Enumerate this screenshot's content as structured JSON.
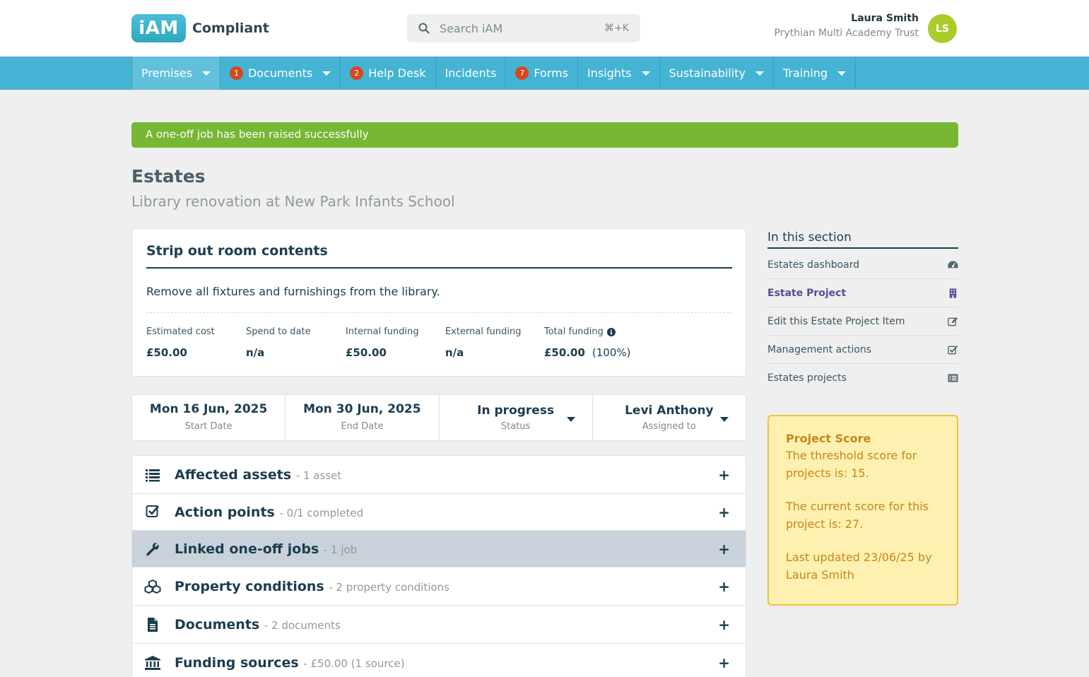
{
  "header": {
    "logo_badge": "iAM",
    "logo_text": "Compliant",
    "search_placeholder": "Search iAM",
    "search_shortcut": "⌘+K",
    "user_name": "Laura Smith",
    "user_org": "Prythian Multi Academy Trust",
    "avatar_initials": "LS"
  },
  "nav": {
    "items": [
      {
        "label": "Premises",
        "badge": null,
        "dropdown": true
      },
      {
        "label": "Documents",
        "badge": "1",
        "dropdown": true
      },
      {
        "label": "Help Desk",
        "badge": "2",
        "dropdown": false
      },
      {
        "label": "Incidents",
        "badge": null,
        "dropdown": false
      },
      {
        "label": "Forms",
        "badge": "7",
        "dropdown": false
      },
      {
        "label": "Insights",
        "badge": null,
        "dropdown": true
      },
      {
        "label": "Sustainability",
        "badge": null,
        "dropdown": true
      },
      {
        "label": "Training",
        "badge": null,
        "dropdown": true
      }
    ]
  },
  "alert": {
    "message": "A one-off job has been raised successfully"
  },
  "page": {
    "title": "Estates",
    "subtitle": "Library renovation at New Park Infants School"
  },
  "card": {
    "title": "Strip out room contents",
    "description": "Remove all fixtures and furnishings from the library.",
    "financials": [
      {
        "label": "Estimated cost",
        "value": "£50.00"
      },
      {
        "label": "Spend to date",
        "value": "n/a"
      },
      {
        "label": "Internal funding",
        "value": "£50.00"
      },
      {
        "label": "External funding",
        "value": "n/a"
      },
      {
        "label": "Total funding",
        "value": "£50.00",
        "pct": "(100%)"
      }
    ]
  },
  "strip": {
    "start_date": "Mon 16 Jun, 2025",
    "start_label": "Start Date",
    "end_date": "Mon 30 Jun, 2025",
    "end_label": "End Date",
    "status": "In progress",
    "status_label": "Status",
    "assignee": "Levi Anthony",
    "assignee_label": "Assigned to"
  },
  "accordion": [
    {
      "icon": "list-icon",
      "title": "Affected assets",
      "meta": "- 1 asset"
    },
    {
      "icon": "check-square-icon",
      "title": "Action points",
      "meta": "- 0/1 completed"
    },
    {
      "icon": "wrench-icon",
      "title": "Linked one-off jobs",
      "meta": "- 1 job"
    },
    {
      "icon": "cubes-icon",
      "title": "Property conditions",
      "meta": "- 2 property conditions"
    },
    {
      "icon": "file-icon",
      "title": "Documents",
      "meta": "- 2 documents"
    },
    {
      "icon": "bank-icon",
      "title": "Funding sources",
      "meta": "- £50.00 (1 source)"
    }
  ],
  "sidebar": {
    "title": "In this section",
    "items": [
      {
        "label": "Estates dashboard",
        "icon": "dashboard-icon"
      },
      {
        "label": "Estate Project",
        "icon": "building-icon"
      },
      {
        "label": "Edit this Estate Project Item",
        "icon": "edit-icon"
      },
      {
        "label": "Management actions",
        "icon": "check-square-icon"
      },
      {
        "label": "Estates projects",
        "icon": "list-alt-icon"
      }
    ]
  },
  "score": {
    "title": "Project Score",
    "threshold_text": "The threshold score for projects is: 15.",
    "current_text": "The current score for this project is: 27.",
    "updated_text": "Last updated 23/06/25 by Laura Smith"
  },
  "colors": {
    "nav_bg": "#45b3d3",
    "alert_bg": "#76b734",
    "badge": "#d8461f",
    "avatar": "#a9cc2a",
    "score_bg": "#fdf0b0",
    "score_border": "#f2c23c",
    "text_dark": "#1c3d4f"
  }
}
